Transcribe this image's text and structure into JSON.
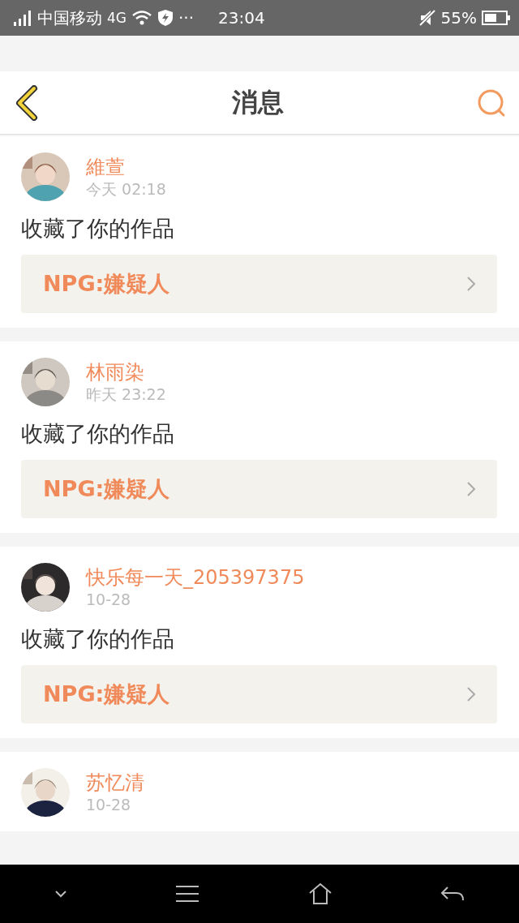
{
  "status_bar": {
    "carrier": "中国移动",
    "network": "4G",
    "more": "···",
    "time": "23:04",
    "battery": "55%"
  },
  "header": {
    "title": "消息"
  },
  "messages": [
    {
      "user": "維萱",
      "time": "今天 02:18",
      "action": "收藏了你的作品",
      "work": "NPG:嫌疑人"
    },
    {
      "user": "林雨染",
      "time": "昨天 23:22",
      "action": "收藏了你的作品",
      "work": "NPG:嫌疑人"
    },
    {
      "user": "快乐每一天_205397375",
      "time": "10-28",
      "action": "收藏了你的作品",
      "work": "NPG:嫌疑人"
    },
    {
      "user": "苏忆清",
      "time": "10-28"
    }
  ]
}
